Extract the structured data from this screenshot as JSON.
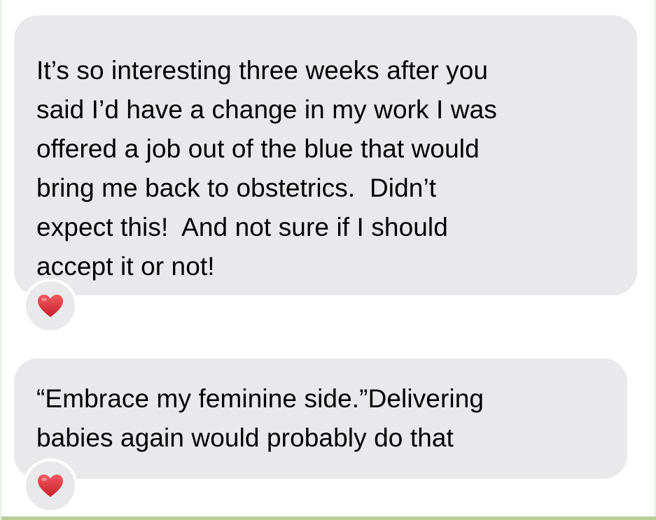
{
  "messages": [
    {
      "lines": [
        "It’s so interesting three weeks after you",
        "said I’d have a change in my work I was",
        "offered a job out of the blue that would",
        "bring me back to obstetrics.  Didn’t",
        "expect this!  And not sure if I should",
        "accept it or not!"
      ],
      "reaction": "heart-icon"
    },
    {
      "lines": [
        "“Embrace my feminine side.”Delivering",
        "babies again would probably do that"
      ],
      "reaction": "heart-icon"
    }
  ],
  "colors": {
    "bubble": "#e9e9eb",
    "text": "#000000",
    "heart": "#e0303a",
    "bottom_strip": "#b7cf95"
  }
}
